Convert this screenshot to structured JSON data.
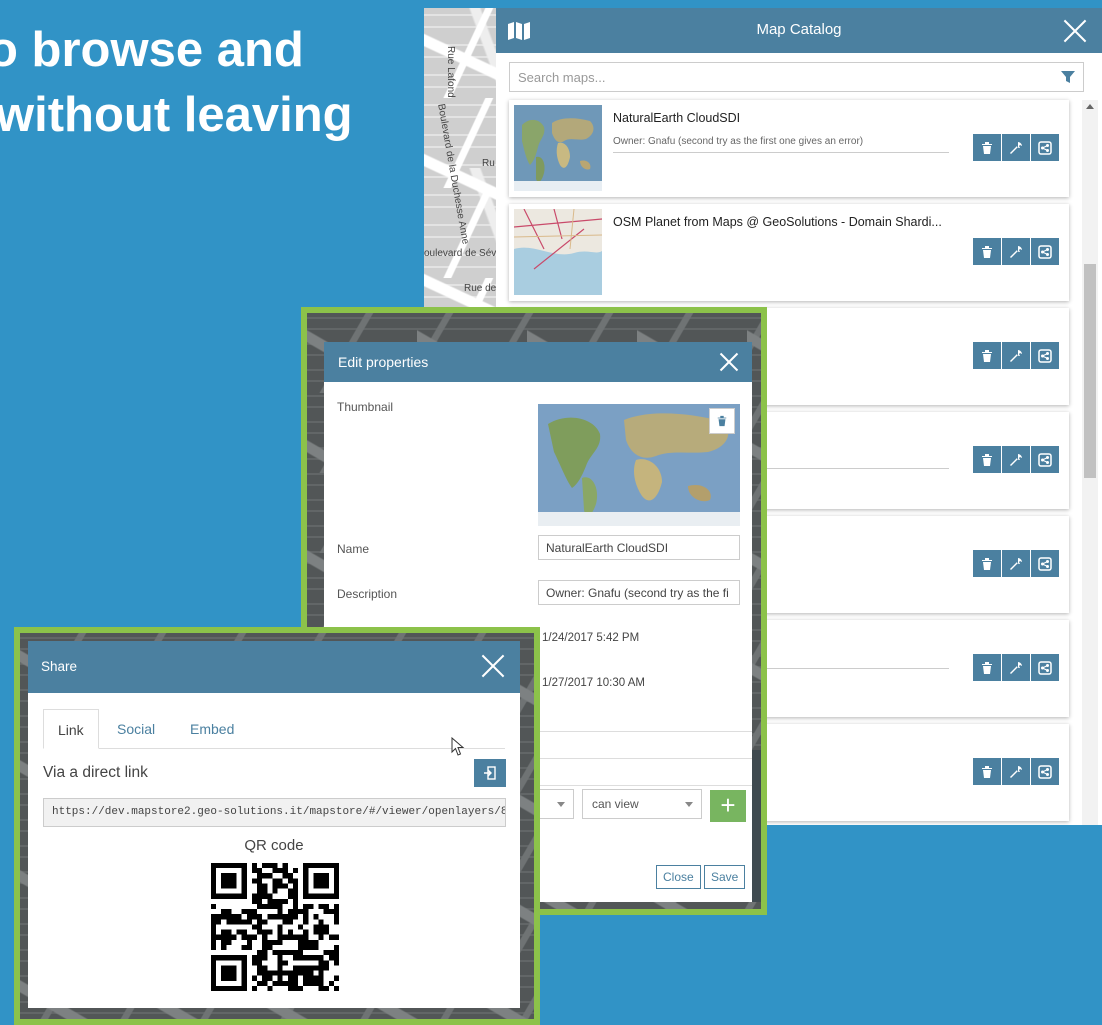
{
  "headline": {
    "line1": "o browse and",
    "line2": "without leaving"
  },
  "map_streets": [
    "Rue Lafond",
    "Boulevard de la Duchesse Anne",
    "Ru",
    "oulevard de Sév",
    "Rue de"
  ],
  "catalog": {
    "title": "Map Catalog",
    "search_placeholder": "Search maps...",
    "cards": [
      {
        "title": "NaturalEarth CloudSDI",
        "description": "Owner: Gnafu (second try as the first one gives an error)"
      },
      {
        "title": "OSM Planet from Maps @ GeoSolutions - Domain Shardi...",
        "description": ""
      },
      {
        "title": "",
        "description": ""
      },
      {
        "title": "",
        "description": ""
      },
      {
        "title": "",
        "description": ""
      },
      {
        "title": "",
        "description": ""
      },
      {
        "title": "",
        "description": ""
      }
    ]
  },
  "edit_properties": {
    "title": "Edit properties",
    "thumbnail_label": "Thumbnail",
    "name_label": "Name",
    "name_value": "NaturalEarth CloudSDI",
    "description_label": "Description",
    "description_value": "Owner: Gnafu (second try as the fi",
    "created": "1/24/2017 5:42 PM",
    "modified": "1/27/2017 10:30 AM",
    "permission_value": "can view",
    "plus_label": "+",
    "close_label": "Close",
    "save_label": "Save"
  },
  "share": {
    "title": "Share",
    "tabs": [
      "Link",
      "Social",
      "Embed"
    ],
    "active_tab": "Link",
    "via_label": "Via a direct link",
    "url": "https://dev.mapstore2.geo-solutions.it/mapstore/#/viewer/openlayers/8",
    "qr_label": "QR code"
  },
  "colors": {
    "accent": "#4b80a0",
    "background": "#3193c6",
    "highlight": "#8cc24a",
    "add": "#78b560"
  }
}
